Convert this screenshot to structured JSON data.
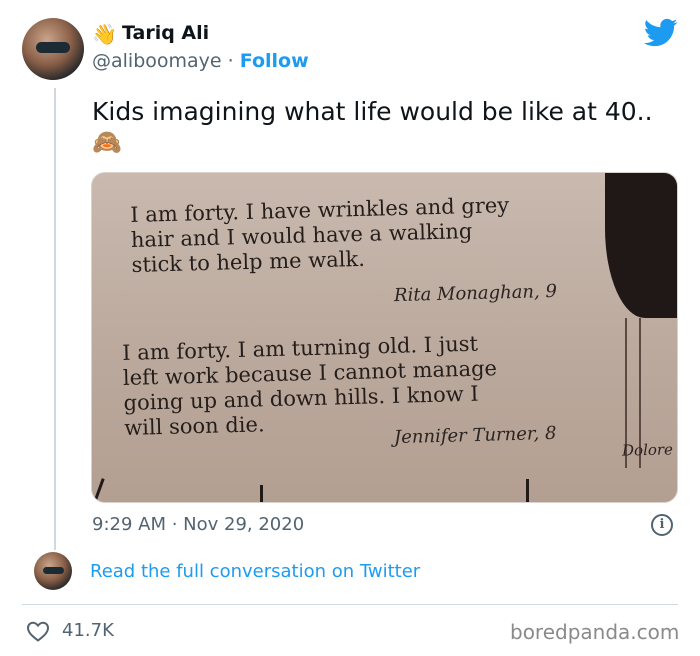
{
  "author": {
    "name": "Tariq Ali",
    "name_emoji": "👋",
    "handle": "@aliboomaye",
    "separator": "·",
    "follow_label": "Follow"
  },
  "tweet": {
    "text": "Kids imagining what life would be like at 40..",
    "emoji": "🙈",
    "timestamp": "9:29 AM · Nov 29, 2020"
  },
  "photo": {
    "paragraph1": [
      "I am forty. I have wrinkles and grey",
      "hair and I would have a walking",
      "stick to help me walk."
    ],
    "signature1": "Rita Monaghan, 9",
    "paragraph2": [
      "I am forty. I am turning old. I just",
      "left work because I cannot manage",
      "going up and down hills. I know I",
      "will soon die."
    ],
    "signature2": "Jennifer Turner, 8",
    "corner_text": "Dolore"
  },
  "footer": {
    "read_link": "Read the full conversation on Twitter",
    "likes": "41.7K",
    "watermark": "boredpanda.com"
  },
  "colors": {
    "accent": "#1d9bf0",
    "muted": "#536471"
  },
  "icons": [
    "twitter-bird-icon",
    "info-icon",
    "heart-icon",
    "wave-hand-icon",
    "monkey-icon"
  ]
}
